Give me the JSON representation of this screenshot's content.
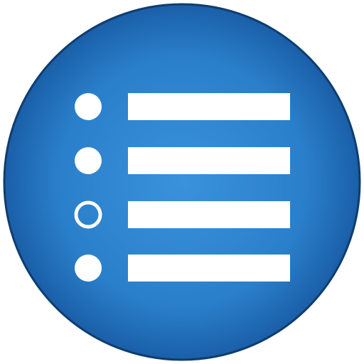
{
  "icon": {
    "name": "bulleted-list-icon",
    "colors": {
      "circle_center": "#3a92dc",
      "circle_mid": "#2a7fca",
      "circle_edge": "#1a5fa8",
      "rim": "#0f3d6e",
      "glyph": "#ffffff"
    },
    "rows": [
      {
        "name": "list-row-1",
        "bullet": "filled"
      },
      {
        "name": "list-row-2",
        "bullet": "filled"
      },
      {
        "name": "list-row-3",
        "bullet": "hollow"
      },
      {
        "name": "list-row-4",
        "bullet": "filled"
      }
    ]
  }
}
